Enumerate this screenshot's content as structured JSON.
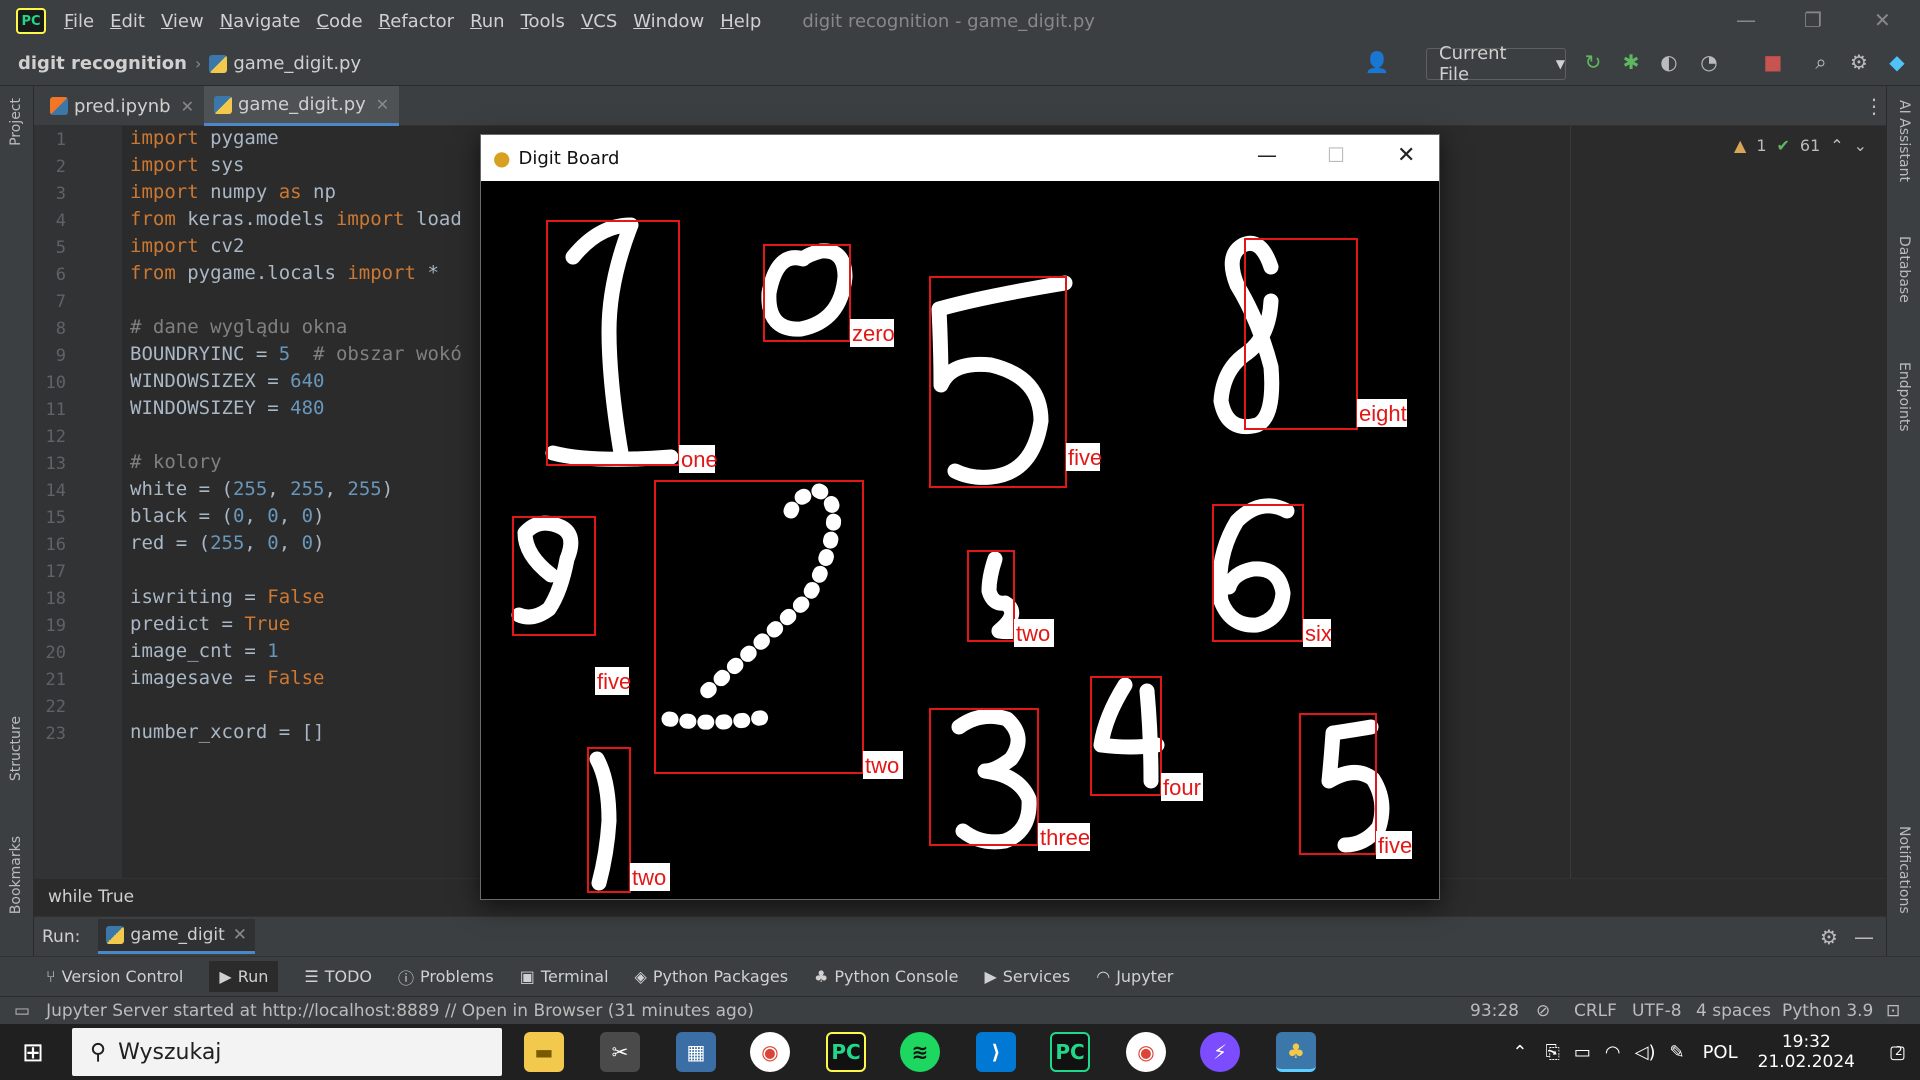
{
  "menubar": {
    "items": [
      "File",
      "Edit",
      "View",
      "Navigate",
      "Code",
      "Refactor",
      "Run",
      "Tools",
      "VCS",
      "Window",
      "Help"
    ],
    "window_title": "digit recognition - game_digit.py"
  },
  "navbar": {
    "project": "digit recognition",
    "file": "game_digit.py",
    "run_config": "Current File"
  },
  "tabs": [
    {
      "label": "pred.ipynb"
    },
    {
      "label": "game_digit.py"
    }
  ],
  "inspections": {
    "warnings": "1",
    "ok": "61"
  },
  "code_lines": [
    "import pygame",
    "import sys",
    "import numpy as np",
    "from keras.models import load",
    "import cv2",
    "from pygame.locals import *",
    "",
    "# dane wyglądu okna",
    "BOUNDRYINC = 5  # obszar wokó",
    "WINDOWSIZEX = 640",
    "WINDOWSIZEY = 480",
    "",
    "# kolory",
    "white = (255, 255, 255)",
    "black = (0, 0, 0)",
    "red = (255, 0, 0)",
    "",
    "iswriting = False",
    "predict = True",
    "image_cnt = 1",
    "imagesave = False",
    "",
    "number_xcord = []"
  ],
  "breadcrumb": "while True",
  "runbar": {
    "label": "Run:",
    "tab": "game_digit"
  },
  "tool_windows": [
    "Version Control",
    "Run",
    "TODO",
    "Problems",
    "Terminal",
    "Python Packages",
    "Python Console",
    "Services",
    "Jupyter"
  ],
  "left_strip": [
    "Project",
    "Structure",
    "Bookmarks"
  ],
  "right_strip": [
    "AI Assistant",
    "Database",
    "Endpoints",
    "Notifications"
  ],
  "status": {
    "message": "Jupyter Server started at http://localhost:8889 // Open in Browser (31 minutes ago)",
    "position": "93:28",
    "line_sep": "CRLF",
    "encoding": "UTF-8",
    "indent": "4 spaces",
    "interpreter": "Python 3.9"
  },
  "pygame_window": {
    "title": "Digit Board",
    "digits": [
      {
        "label": "one"
      },
      {
        "label": "zero"
      },
      {
        "label": "five"
      },
      {
        "label": "eight"
      },
      {
        "label": "five"
      },
      {
        "label": "two"
      },
      {
        "label": "two"
      },
      {
        "label": "six"
      },
      {
        "label": "two"
      },
      {
        "label": "three"
      },
      {
        "label": "four"
      },
      {
        "label": "five"
      }
    ]
  },
  "taskbar": {
    "search_placeholder": "Wyszukaj",
    "language": "POL",
    "time": "19:32",
    "date": "21.02.2024",
    "notifications": "2"
  },
  "colors": {
    "accent": "#4a88c7",
    "box": "#e21818",
    "keyword": "#cc7832",
    "number": "#6897bb"
  }
}
